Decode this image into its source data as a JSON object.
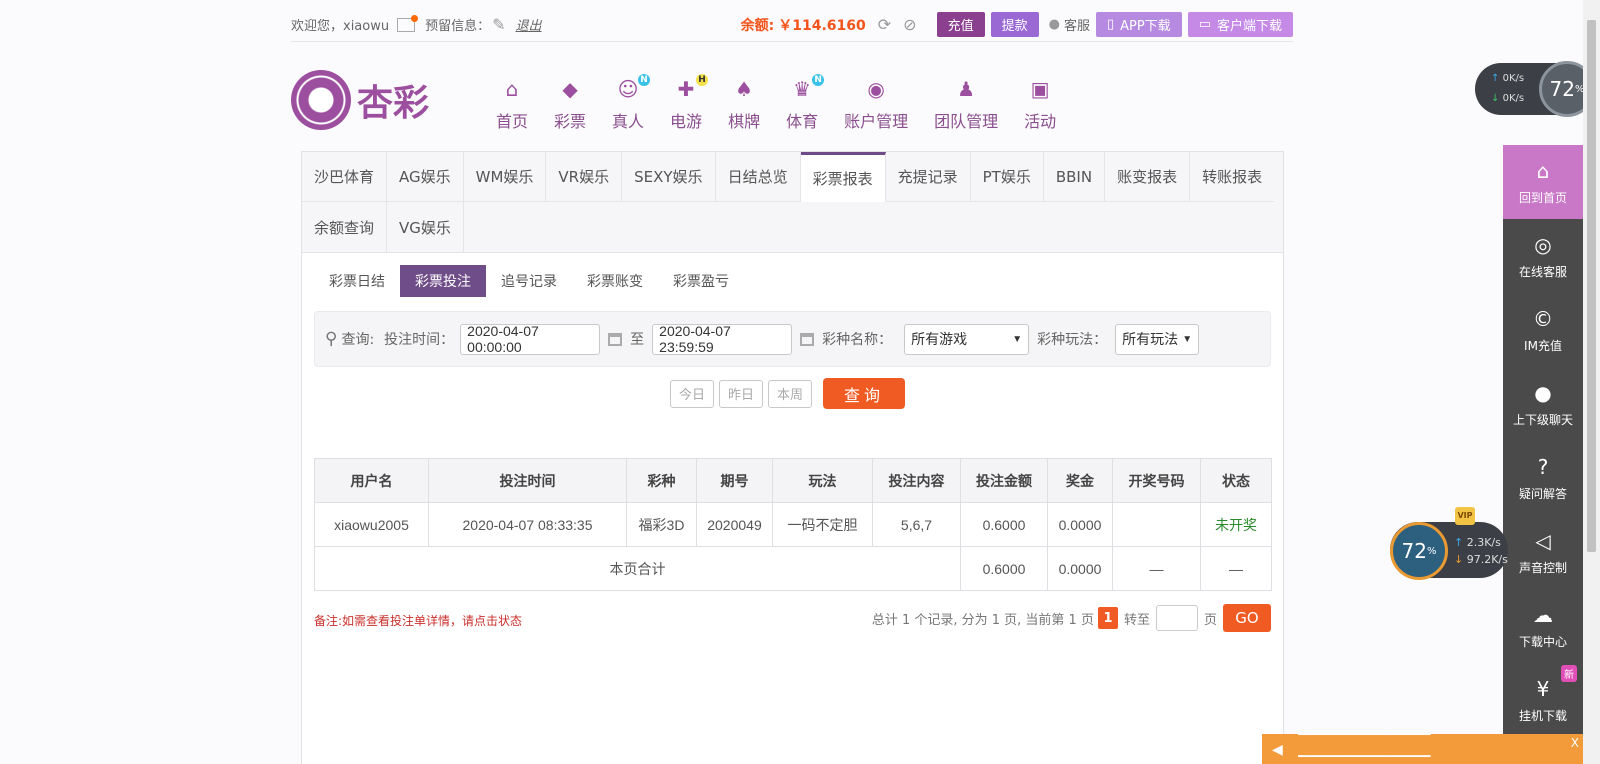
{
  "topbar": {
    "welcome": "欢迎您，xiaowu",
    "reserved_info": "预留信息：",
    "logout": "退出",
    "balance_label": "余额:",
    "balance_value": "￥114.6160",
    "recharge": "充值",
    "withdraw": "提款",
    "service": "客服",
    "app_download": "APP下载",
    "client_download": "客户端下载"
  },
  "logo": {
    "text": "杏彩"
  },
  "nav": [
    {
      "label": "首页",
      "icon": "home-icon"
    },
    {
      "label": "彩票",
      "icon": "lottery-ticket-icon"
    },
    {
      "label": "真人",
      "icon": "live-dealer-icon",
      "badge": "N"
    },
    {
      "label": "电游",
      "icon": "gamepad-icon",
      "badge": "H"
    },
    {
      "label": "棋牌",
      "icon": "cards-icon"
    },
    {
      "label": "体育",
      "icon": "trophy-icon",
      "badge": "N"
    },
    {
      "label": "账户管理",
      "icon": "account-icon"
    },
    {
      "label": "团队管理",
      "icon": "team-icon"
    },
    {
      "label": "活动",
      "icon": "gift-icon"
    }
  ],
  "tabs": [
    "沙巴体育",
    "AG娱乐",
    "WM娱乐",
    "VR娱乐",
    "SEXY娱乐",
    "日结总览",
    "彩票报表",
    "充提记录",
    "PT娱乐",
    "BBIN",
    "账变报表",
    "转账报表",
    "余额查询",
    "VG娱乐"
  ],
  "active_tab": "彩票报表",
  "subtabs": [
    "彩票日结",
    "彩票投注",
    "追号记录",
    "彩票账变",
    "彩票盈亏"
  ],
  "active_subtab": "彩票投注",
  "filter": {
    "query_label": "查询:",
    "bet_time_label": "投注时间：",
    "start": "2020-04-07 00:00:00",
    "to": "至",
    "end": "2020-04-07 23:59:59",
    "lottery_name_label": "彩种名称：",
    "lottery_name_value": "所有游戏",
    "play_label": "彩种玩法：",
    "play_value": "所有玩法"
  },
  "quick": {
    "today": "今日",
    "yesterday": "昨日",
    "week": "本周",
    "search": "查询"
  },
  "table": {
    "headers": [
      "用户名",
      "投注时间",
      "彩种",
      "期号",
      "玩法",
      "投注内容",
      "投注金额",
      "奖金",
      "开奖号码",
      "状态"
    ],
    "row": {
      "user": "xiaowu2005",
      "time": "2020-04-07 08:33:35",
      "lottery": "福彩3D",
      "issue": "2020049",
      "play": "一码不定胆",
      "content": "5,6,7",
      "amount": "0.6000",
      "bonus": "0.0000",
      "draw": "",
      "status": "未开奖"
    },
    "total": {
      "label": "本页合计",
      "amount": "0.6000",
      "bonus": "0.0000",
      "draw": "—",
      "status": "—"
    }
  },
  "note": "备注:如需查看投注单详情，请点击状态",
  "pager": {
    "summary": "总计 1 个记录, 分为 1 页, 当前第 1 页",
    "current": "1",
    "goto": "转至",
    "page": "页",
    "go": "GO"
  },
  "sidebar": [
    {
      "label": "回到首页",
      "icon": "home-icon"
    },
    {
      "label": "在线客服",
      "icon": "headset-24-icon"
    },
    {
      "label": "IM充值",
      "icon": "im-recharge-icon"
    },
    {
      "label": "上下级聊天",
      "icon": "chat-bubble-icon"
    },
    {
      "label": "疑问解答",
      "icon": "question-icon"
    },
    {
      "label": "声音控制",
      "icon": "speaker-icon"
    },
    {
      "label": "下载中心",
      "icon": "cloud-download-icon"
    },
    {
      "label": "挂机下载",
      "icon": "money-bag-icon",
      "badge": "新"
    }
  ],
  "speed1": {
    "up": "0K/s",
    "down": "0K/s",
    "percent": "72",
    "unit": "%"
  },
  "speed2": {
    "up": "2.3K/s",
    "down": "97.2K/s",
    "percent": "72",
    "unit": "%",
    "vip": "VIP"
  },
  "notice": {
    "close": "X"
  }
}
